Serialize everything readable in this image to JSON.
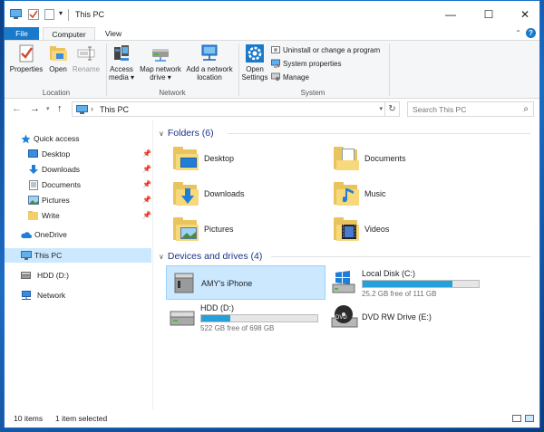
{
  "window": {
    "title": "This PC",
    "qat_dropdown": "▾",
    "controls": {
      "minimize": "—",
      "maximize": "☐",
      "close": "✕"
    }
  },
  "ribbon_tabs": {
    "file": "File",
    "computer": "Computer",
    "view": "View",
    "expand": "⌃",
    "help": "?"
  },
  "ribbon": {
    "location": {
      "label": "Location",
      "properties": "Properties",
      "open": "Open",
      "rename": "Rename"
    },
    "network": {
      "label": "Network",
      "access_media_1": "Access",
      "access_media_2": "media ▾",
      "map_drive_1": "Map network",
      "map_drive_2": "drive ▾",
      "add_location_1": "Add a network",
      "add_location_2": "location"
    },
    "system": {
      "label": "System",
      "open_settings_1": "Open",
      "open_settings_2": "Settings",
      "uninstall": "Uninstall or change a program",
      "system_properties": "System properties",
      "manage": "Manage"
    }
  },
  "address": {
    "back": "←",
    "forward": "→",
    "recent": "▾",
    "up": "↑",
    "crumb_sep": "›",
    "path": "This PC",
    "dropdown": "▾",
    "refresh": "↻",
    "search_placeholder": "Search This PC",
    "search_icon": "⌕"
  },
  "nav_pane": {
    "pin_glyph": "📌",
    "quick_access": "Quick access",
    "quick_items": [
      {
        "label": "Desktop",
        "pinned": true
      },
      {
        "label": "Downloads",
        "pinned": true
      },
      {
        "label": "Documents",
        "pinned": true
      },
      {
        "label": "Pictures",
        "pinned": true
      },
      {
        "label": "Write",
        "pinned": true
      }
    ],
    "onedrive": "OneDrive",
    "this_pc": "This PC",
    "hdd": "HDD (D:)",
    "network": "Network"
  },
  "folders_section": {
    "title": "Folders (6)",
    "items": [
      "Desktop",
      "Documents",
      "Downloads",
      "Music",
      "Pictures",
      "Videos"
    ]
  },
  "drives_section": {
    "title": "Devices and drives (4)",
    "items": [
      {
        "label": "AMY's iPhone"
      },
      {
        "label": "Local Disk (C:)",
        "free": "25.2 GB free of 111 GB",
        "used_fraction": 0.77
      },
      {
        "label": "HDD (D:)",
        "free": "522 GB free of 698 GB",
        "used_fraction": 0.25
      },
      {
        "label": "DVD RW Drive (E:)",
        "dvd_badge": "DVD"
      }
    ]
  },
  "status_bar": {
    "count": "10 items",
    "selection": "1 item selected"
  }
}
